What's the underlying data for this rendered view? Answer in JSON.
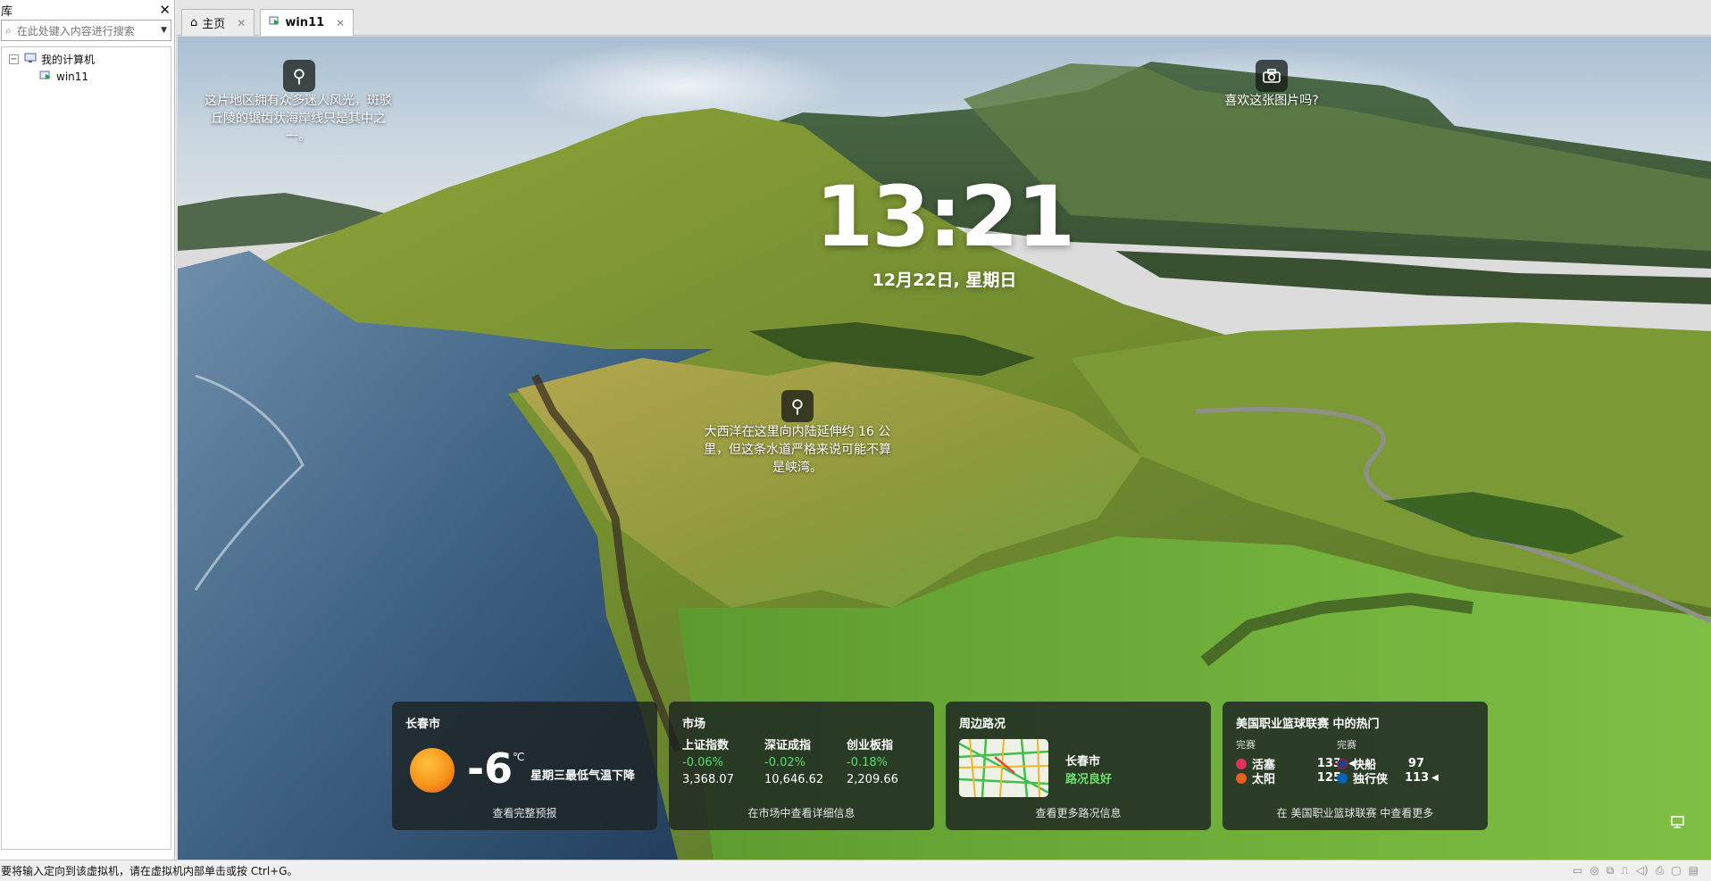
{
  "library": {
    "title": "库",
    "search_placeholder": "在此处键入内容进行搜索",
    "tree": {
      "root_label": "我的计算机",
      "child_label": "win11"
    }
  },
  "tabs": [
    {
      "label": "主页",
      "icon": "home-icon",
      "active": false
    },
    {
      "label": "win11",
      "icon": "vm-icon",
      "active": true
    }
  ],
  "lockscreen": {
    "time": "13:21",
    "date": "12月22日, 星期日",
    "spots": [
      {
        "text": "这片地区拥有众多迷人风光，斑驳丘陵的锯齿状海岸线只是其中之一。",
        "icon": "magnifier-icon"
      },
      {
        "text": "大西洋在这里向内陆延伸约 16 公里，但这条水道严格来说可能不算是峡湾。",
        "icon": "magnifier-icon"
      },
      {
        "text": "喜欢这张图片吗?",
        "icon": "camera-icon"
      }
    ],
    "weather": {
      "city": "长春市",
      "temp": "-6",
      "unit": "℃",
      "desc": "星期三最低气温下降",
      "link": "查看完整预报"
    },
    "market": {
      "title": "市场",
      "items": [
        {
          "name": "上证指数",
          "change": "-0.06%",
          "value": "3,368.07"
        },
        {
          "name": "深证成指",
          "change": "-0.02%",
          "value": "10,646.62"
        },
        {
          "name": "创业板指",
          "change": "-0.18%",
          "value": "2,209.66"
        }
      ],
      "link": "在市场中查看详细信息"
    },
    "traffic": {
      "title": "周边路况",
      "city": "长春市",
      "status": "路况良好",
      "link": "查看更多路况信息"
    },
    "nba": {
      "title": "美国职业篮球联赛 中的热门",
      "games": [
        {
          "status": "完赛",
          "home": {
            "team": "活塞",
            "score": "133"
          },
          "away": {
            "team": "太阳",
            "score": "125"
          }
        },
        {
          "status": "完赛",
          "home": {
            "team": "快船",
            "score": "97"
          },
          "away": {
            "team": "独行侠",
            "score": "113"
          }
        }
      ],
      "link": "在 美国职业篮球联赛 中查看更多"
    },
    "colors": {
      "positive": "#5edc70",
      "traffic_ok": "#6ee26a"
    }
  },
  "statusbar": {
    "message": "要将输入定向到该虚拟机，请在虚拟机内部单击或按 Ctrl+G。"
  }
}
